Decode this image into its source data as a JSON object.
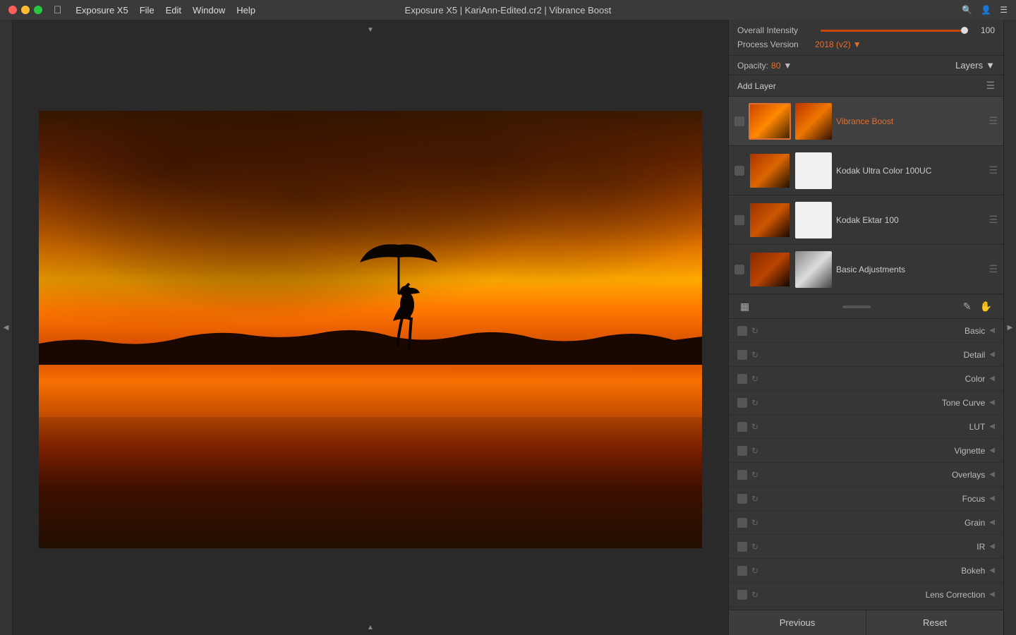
{
  "titlebar": {
    "app_name": "Exposure X5",
    "menu_items": [
      "Apple",
      "Exposure X5",
      "File",
      "Edit",
      "Window",
      "Help"
    ],
    "title": "Exposure X5 | KariAnn-Edited.cr2 | Vibrance Boost"
  },
  "panel": {
    "overall_intensity_label": "Overall Intensity",
    "overall_intensity_value": "100",
    "process_version_label": "Process Version",
    "process_version_value": "2018 (v2)",
    "opacity_label": "Opacity:",
    "opacity_value": "80",
    "layers_label": "Layers",
    "add_layer_label": "Add Layer"
  },
  "layers": [
    {
      "name": "Vibrance Boost",
      "active": true
    },
    {
      "name": "Kodak Ultra Color 100UC",
      "active": false
    },
    {
      "name": "Kodak Ektar 100",
      "active": false
    },
    {
      "name": "Basic Adjustments",
      "active": false
    }
  ],
  "adjustments": [
    {
      "name": "Basic"
    },
    {
      "name": "Detail"
    },
    {
      "name": "Color"
    },
    {
      "name": "Tone Curve"
    },
    {
      "name": "LUT"
    },
    {
      "name": "Vignette"
    },
    {
      "name": "Overlays"
    },
    {
      "name": "Focus"
    },
    {
      "name": "Grain"
    },
    {
      "name": "IR"
    },
    {
      "name": "Bokeh"
    },
    {
      "name": "Lens Correction"
    }
  ],
  "bottom_buttons": {
    "previous": "Previous",
    "reset": "Reset"
  }
}
